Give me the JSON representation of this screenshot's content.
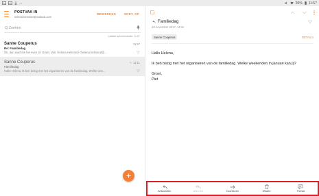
{
  "statusbar": {
    "left_icons": [
      "image-icon",
      "image-icon",
      "download-icon"
    ],
    "left_ellipsis": "...",
    "battery_text": "86%",
    "time": "11:57"
  },
  "mailbox": {
    "title": "POSTVAK IN",
    "email": "helena.helmond@outlook.com",
    "edit_label": "BEWERKEN",
    "sort_label": "SORT. OP"
  },
  "search": {
    "placeholder": "Q Zoeken"
  },
  "sync_text": "Laatste synchronisatie: 11:57",
  "mails": [
    {
      "sender": "Sanne Couperus",
      "time": "11:57",
      "subject": "Re: Familiedag",
      "preview": "Ok, dan wacht ik het even af. Groet, Van: Helena Helmond <helena.helmond@..."
    },
    {
      "sender": "Sanne Couperus",
      "time": "11:11",
      "subject": "Familiedag",
      "preview": "Hallo Helena, Ik ben bezig met het organiseren van de familiedag. Welke wee..."
    }
  ],
  "message": {
    "subject": "Familiedag",
    "date": "28 november 2017, 11:11",
    "sender": "Sanne Couperus",
    "details_label": "DETAILS",
    "greeting": "Hallo Helena,",
    "body": "Ik ben bezig met het organiseren van de familiedag. Welke weekenden in januari kan jij?",
    "closing": "Groet,",
    "signature": "Piet"
  },
  "toolbar": {
    "items": [
      {
        "label": "Antwoorden",
        "icon": "reply-icon"
      },
      {
        "label": "Allen Ant.",
        "icon": "reply-all-icon"
      },
      {
        "label": "Doorsturen",
        "icon": "forward-icon"
      },
      {
        "label": "Wissen",
        "icon": "trash-icon"
      },
      {
        "label": "Thread",
        "icon": "thread-icon"
      }
    ]
  },
  "colors": {
    "accent": "#f28a3a",
    "fab": "#f47f36",
    "highlight_border": "#d61f26"
  }
}
